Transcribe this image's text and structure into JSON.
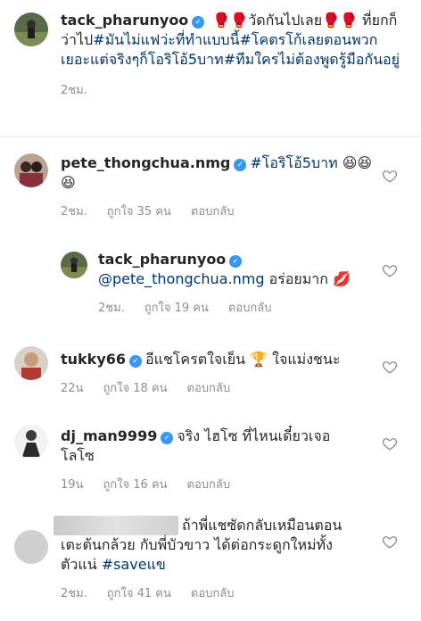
{
  "caption": {
    "username": "tack_pharunyoo",
    "prefix_emoji": "🥊🥊",
    "text_1": "วัดกันไปเลย",
    "mid_emoji": "🥊🥊",
    "text_2": " ที่ยกก็ว่าไป",
    "tag_1": "#มันไม่แฟว่ะที่ทำแบบนี้",
    "tag_2": "#โคตรโก้เลยตอนพวกเยอะแต่จริงๆก็โอริโอ้5บาท",
    "tag_3": "#ทีมใครไม่ต้องพูดรู้มือกันอยู่",
    "time": "2ชม."
  },
  "comments": [
    {
      "username": "pete_thongchua.nmg",
      "hashtag": "#โอริโอ้5บาท",
      "emoji": "😆😆😆",
      "time": "2ชม.",
      "likes": "ถูกใจ 35 คน",
      "reply": "ตอบกลับ"
    },
    {
      "username": "tack_pharunyoo",
      "mention": "@pete_thongchua.nmg",
      "text": " อร่อยมาก",
      "emoji": "💋",
      "time": "2ชม.",
      "likes": "ถูกใจ 19 คน",
      "reply": "ตอบกลับ"
    },
    {
      "username": "tukky66",
      "text_1": "อีแชโครตใจเย็น",
      "emoji": "🏆",
      "text_2": "ใจแม่งชนะ",
      "time": "22น",
      "likes": "ถูกใจ 18 คน",
      "reply": "ตอบกลับ"
    },
    {
      "username": "dj_man9999",
      "text": "จริง ไฮโซ ที่ไหนเดี๋ยวเจอ โลโซ",
      "time": "19น",
      "likes": "ถูกใจ 16 คน",
      "reply": "ตอบกลับ"
    },
    {
      "text_1": "ถ้าพี่แชซัดกลับเหมือนตอน",
      "text_2": "เตะต้นกล้วย กับพี่บัวขาว ได้ต่อกระดูกใหม่ทั้ง",
      "text_3": "ตัวแน่ ",
      "hashtag": "#saveแข",
      "time": "2ชม.",
      "likes": "ถูกใจ 41 คน",
      "reply": "ตอบกลับ"
    }
  ],
  "icons": {
    "verified": "verified-badge-icon",
    "like": "heart-outline-icon"
  },
  "colors": {
    "link": "#003569",
    "verified": "#3897f0",
    "meta": "#8e8e8e"
  }
}
